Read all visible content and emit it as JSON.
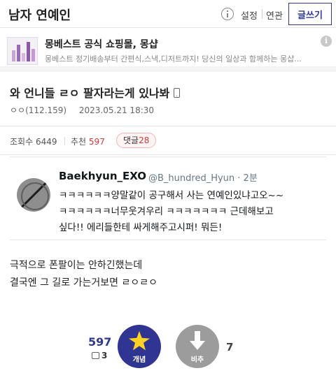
{
  "header": {
    "board_title": "남자 연예인",
    "info_icon": "info-circle-icon",
    "settings_label": "설정",
    "related_label": "연관",
    "write_label": "글쓰기"
  },
  "ad": {
    "title": "몽베스트 공식 쇼핑몰, 몽샵",
    "description": "몽베스트 정기배송부터 간편식,스낵,디저트까지! 당신의 일상과 함께하는 몽샵...",
    "info_icon": "ad-info-icon"
  },
  "post": {
    "title": "와 언니들 ㄹㅇ 팔자라는게 있나봐",
    "device_icon": "mobile-phone-icon",
    "author": "ㅇㅇ(112.159)",
    "date": "2023.05.21 18:30"
  },
  "stats": {
    "views_label": "조회수",
    "views": "6449",
    "recommend_label": "추천",
    "recommend": "597",
    "replies_label": "댓글",
    "replies": "28"
  },
  "tweet": {
    "display_name": "Baekhyun_EXO",
    "handle_time": "@B_hundred_Hyun · 2분",
    "lines": [
      "ㅋㅋㅋㅋㅋㅋ양말같이 공구해서 사는 연예인있냐고오~~",
      "ㅋㅋㅋㅋㅋㅋ너무웃겨우리 ㅋㅋㅋㅋㅋㅋㅋ 근데해보고",
      "싶다!! 에리들한테 싸게해주고시퍼! 뭐든!"
    ]
  },
  "body": {
    "lines": [
      "극적으로 폰팔이는 안하긴했는데",
      "결국엔 그 길로 가는거보면 ㄹㅇㄹㅇ"
    ]
  },
  "vote": {
    "up_count": "597",
    "fixed_count": "3",
    "up_label": "개념",
    "down_label": "비추",
    "down_count": "7",
    "up_color": "#2f3591",
    "star_color": "#ffd324",
    "down_color": "#9c9c9c"
  }
}
